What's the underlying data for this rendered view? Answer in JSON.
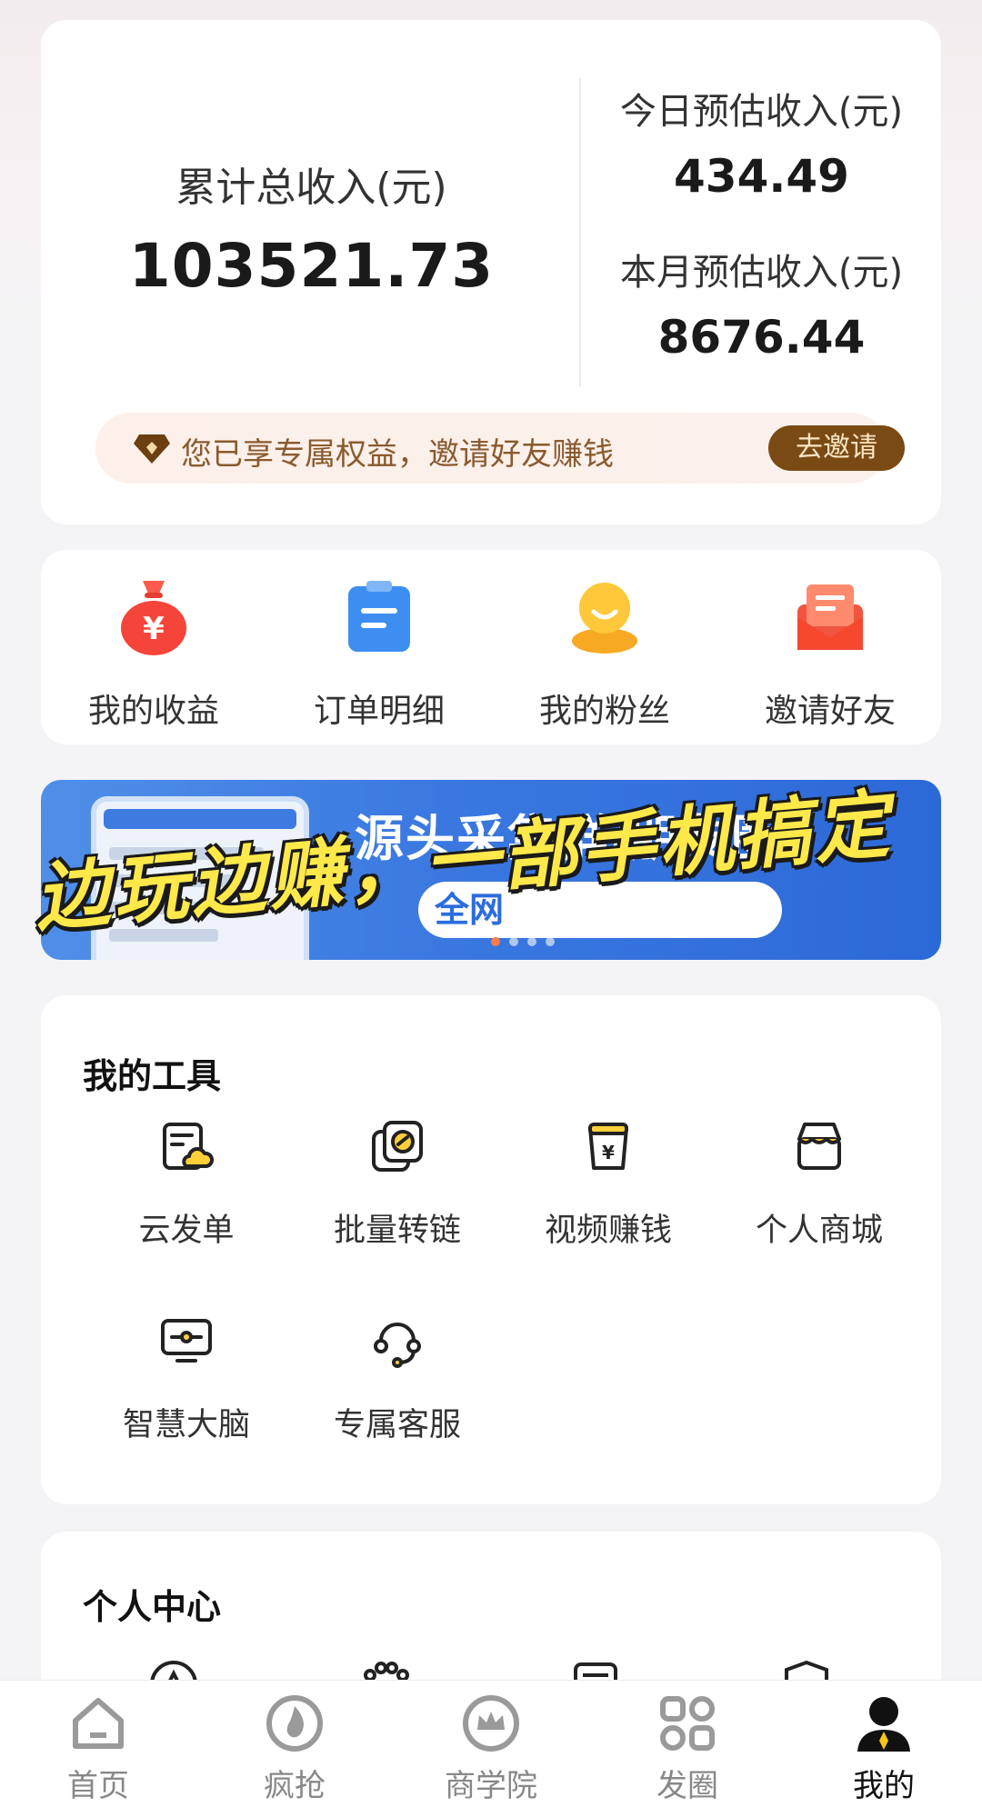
{
  "income": {
    "total_label": "累计总收入(元)",
    "total_value": "103521.73",
    "today_label": "今日预估收入(元)",
    "today_value": "434.49",
    "month_label": "本月预估收入(元)",
    "month_value": "8676.44"
  },
  "benefit": {
    "text": "您已享专属权益，邀请好友赚钱",
    "button_label": "去邀请"
  },
  "quick_actions": [
    {
      "label": "我的收益",
      "icon": "money-bag-icon"
    },
    {
      "label": "订单明细",
      "icon": "clipboard-icon"
    },
    {
      "label": "我的粉丝",
      "icon": "fans-smile-icon"
    },
    {
      "label": "邀请好友",
      "icon": "envelope-icon"
    }
  ],
  "banner": {
    "title": "源头采集群/朋友圈",
    "pill_text": "全网",
    "slogan": "边玩边赚，一部手机搞定"
  },
  "tools": {
    "title": "我的工具",
    "items": [
      {
        "label": "云发单",
        "icon": "cloud-document-icon"
      },
      {
        "label": "批量转链",
        "icon": "link-copy-icon"
      },
      {
        "label": "视频赚钱",
        "icon": "video-yuan-icon"
      },
      {
        "label": "个人商城",
        "icon": "store-icon"
      },
      {
        "label": "智慧大脑",
        "icon": "monitor-icon"
      },
      {
        "label": "专属客服",
        "icon": "headset-icon"
      }
    ]
  },
  "personal": {
    "title": "个人中心"
  },
  "nav": {
    "items": [
      {
        "label": "首页",
        "icon": "home-icon"
      },
      {
        "label": "疯抢",
        "icon": "flame-icon"
      },
      {
        "label": "商学院",
        "icon": "crown-icon"
      },
      {
        "label": "发圈",
        "icon": "grid-icon"
      },
      {
        "label": "我的",
        "icon": "person-icon"
      }
    ],
    "active_index": 4
  },
  "colors": {
    "accent_brown": "#7a4a15",
    "banner_blue": "#3a78e0",
    "slogan_yellow": "#ffe94a"
  }
}
